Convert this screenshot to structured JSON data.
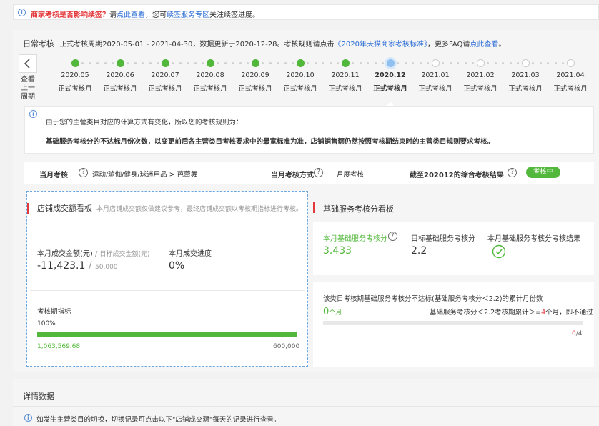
{
  "notice": {
    "question": "商家考核是否影响续签？",
    "pre_link": "请",
    "link1": "点此查看",
    "mid": "，您可",
    "link2": "续签服务专区",
    "post": "关注续签进度。"
  },
  "header": {
    "title": "日常考核",
    "period_text": "正式考核周期2020-05-01 - 2021-04-30，数据更新于2020-12-28。考核规则请点击",
    "rules_link": "《2020年天猫商家考核标准》",
    "faq_text": "，更多FAQ请",
    "faq_link": "点此查看",
    "faq_end": "。"
  },
  "timeline": {
    "back_label": "查看上一周期",
    "months": [
      {
        "month": "2020.05",
        "label": "正式考核月",
        "status": "done"
      },
      {
        "month": "2020.06",
        "label": "正式考核月",
        "status": "done"
      },
      {
        "month": "2020.07",
        "label": "正式考核月",
        "status": "done"
      },
      {
        "month": "2020.08",
        "label": "正式考核月",
        "status": "done"
      },
      {
        "month": "2020.09",
        "label": "正式考核月",
        "status": "done"
      },
      {
        "month": "2020.10",
        "label": "正式考核月",
        "status": "done"
      },
      {
        "month": "2020.11",
        "label": "正式考核月",
        "status": "done"
      },
      {
        "month": "2020.12",
        "label": "正式考核月",
        "status": "current"
      },
      {
        "month": "2021.01",
        "label": "正式考核月",
        "status": "future"
      },
      {
        "month": "2021.02",
        "label": "正式考核月",
        "status": "future"
      },
      {
        "month": "2021.03",
        "label": "正式考核月",
        "status": "future"
      },
      {
        "month": "2021.04",
        "label": "正式考核月",
        "status": "future"
      }
    ]
  },
  "rule_box": {
    "line1": "由于您的主营类目对应的计算方式有变化，所以您的考核规则为：",
    "line2": "基础服务考核分的不达标月份次数，以变更前后各主营类目考核要求中的最宽标准为准，店铺销售额仍然按照考核期结束时的主营类目规则要求考核。"
  },
  "summary": {
    "month_label": "当月考核",
    "category": "运动/瑜伽/健身/球迷用品 > 芭蕾舞",
    "method_label": "当月考核方式",
    "method_value": "月度考核",
    "result_label": "截至202012的综合考核结果",
    "result_badge": "考核中"
  },
  "sales": {
    "title": "店铺成交额看板",
    "note": "本月店铺成交额仅做建议参考，最终店铺成交额以考核期指标进行考核。",
    "amount_label": "本月成交金额(元)",
    "target_label": "目标成交金额(元)",
    "amount_value": "-11,423.1",
    "target_value": "50,000",
    "progress_label": "本月成交进度",
    "progress_value": "0%",
    "period_label": "考核期指标",
    "period_percent": "100%",
    "period_progress": 100,
    "period_current": "1,063,569.68",
    "period_target": "600,000"
  },
  "service": {
    "title": "基础服务考核分看板",
    "score_label": "本月基础服务考核分",
    "score_value": "3.433",
    "target_label": "目标基础服务考核分",
    "target_value": "2.2",
    "result_label": "本月基础服务考核分考核结果",
    "months_desc": "该类目考核期基础服务考核分不达标(基础服务考核分＜2.2)的累计月份数",
    "months_count": "0",
    "months_unit": "个月",
    "rule_text_a": "基础服务考核分＜2.2考核期累计＞=",
    "rule_num": "4",
    "rule_text_b": "个月，即不通过",
    "ratio_num": "0",
    "ratio_den": "/4"
  },
  "details": {
    "title": "详情数据",
    "tip": "如发生主营类目的切换，切换记录可点击以下\"店铺成交额\"每天的记录进行查看。"
  },
  "colors": {
    "accent_green": "#52b83b",
    "link_blue": "#2e6ed6",
    "alert_red": "#e4393c",
    "current_blue": "#8fc0f0"
  }
}
